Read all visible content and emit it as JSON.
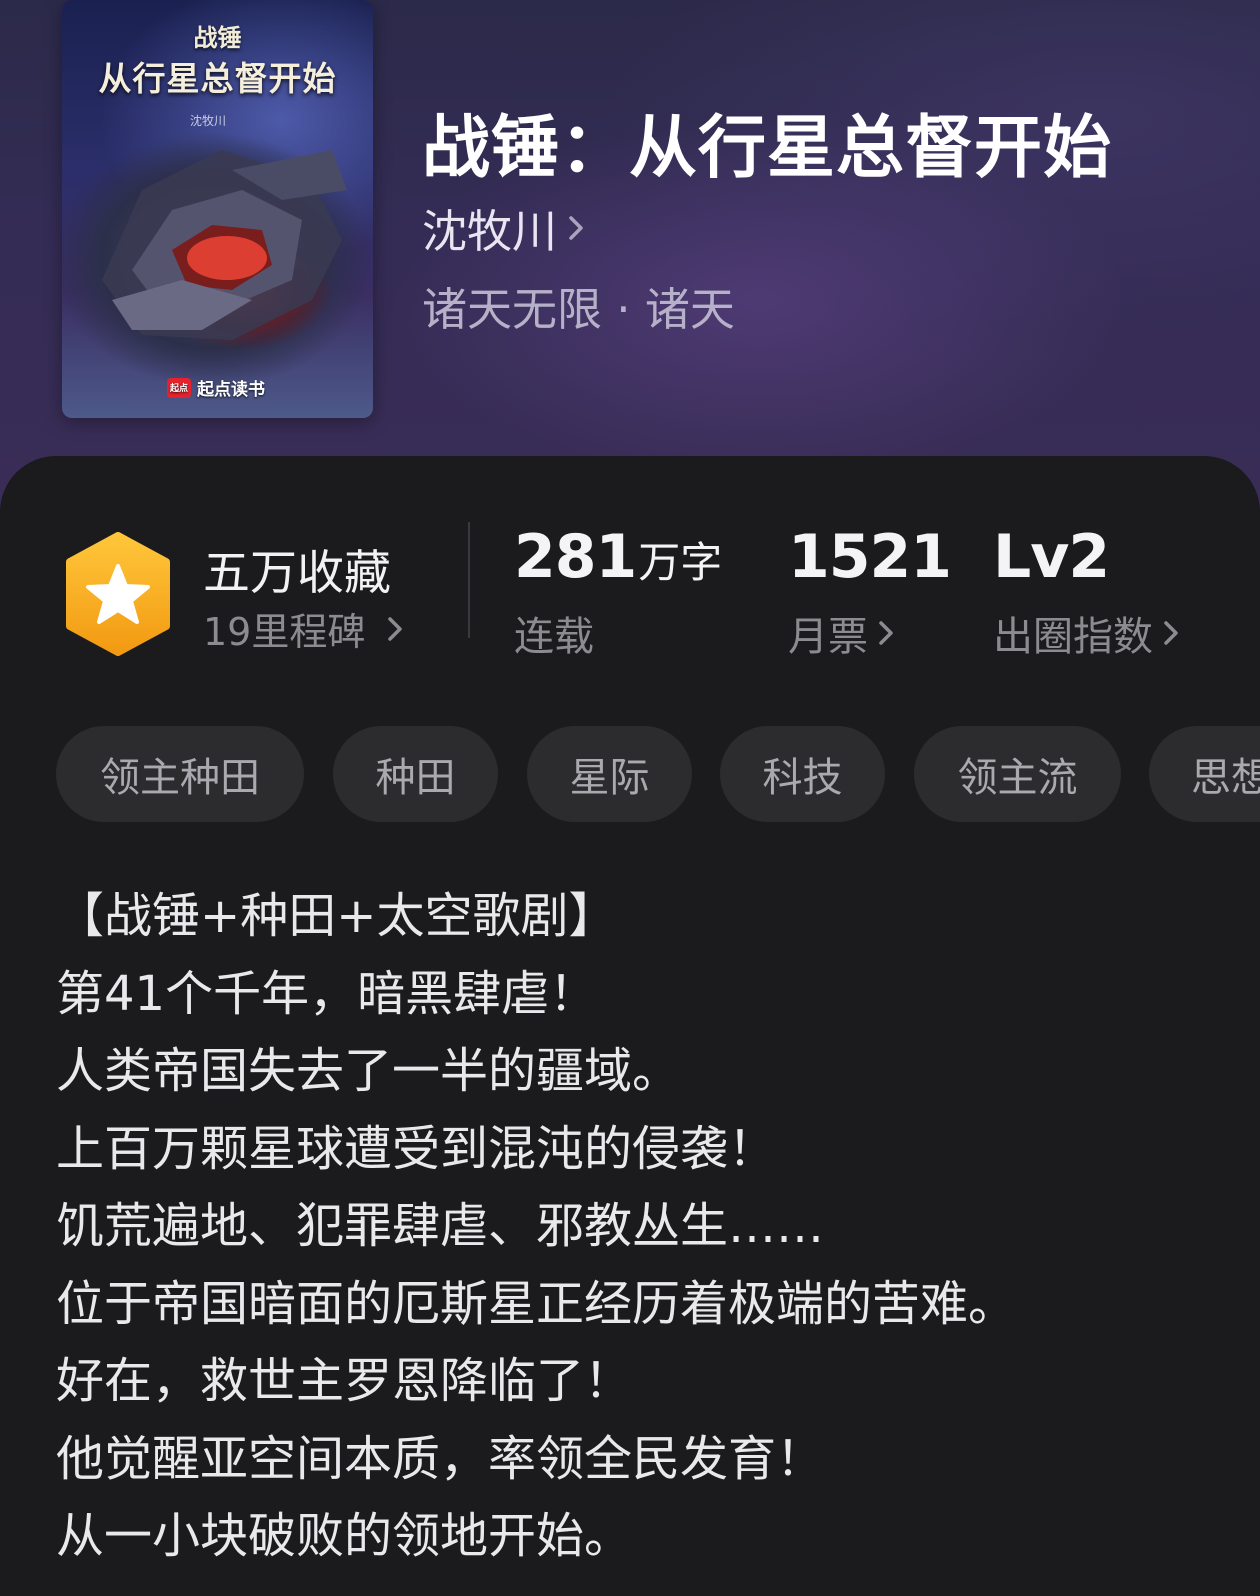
{
  "book": {
    "title": "战锤：从行星总督开始",
    "author": "沈牧川",
    "genre": "诸天无限 · 诸天",
    "cover": {
      "title_small": "战锤",
      "title_big": "从行星总督开始",
      "author": "沈牧川",
      "logo_mark": "起点",
      "logo_text": "起点读书"
    }
  },
  "stats": {
    "favorites": {
      "title": "五万收藏",
      "subtitle": "19里程碑"
    },
    "words": {
      "value": "281",
      "unit": "万字",
      "label": "连载"
    },
    "monthly_tickets": {
      "value": "1521",
      "label": "月票"
    },
    "level": {
      "value": "Lv2",
      "label": "出圈指数"
    }
  },
  "tags": [
    "领主种田",
    "种田",
    "星际",
    "科技",
    "领主流",
    "思想"
  ],
  "description": [
    "【战锤+种田+太空歌剧】",
    "第41个千年，暗黑肆虐！",
    "人类帝国失去了一半的疆域。",
    "上百万颗星球遭受到混沌的侵袭！",
    "饥荒遍地、犯罪肆虐、邪教丛生……",
    "位于帝国暗面的厄斯星正经历着极端的苦难。",
    "好在，救世主罗恩降临了！",
    "他觉醒亚空间本质，率领全民发育！",
    "从一小块破败的领地开始。"
  ],
  "colors": {
    "badge": "#f5a623",
    "background": "#1b1b1d",
    "tag_bg": "#2c2c2f"
  }
}
